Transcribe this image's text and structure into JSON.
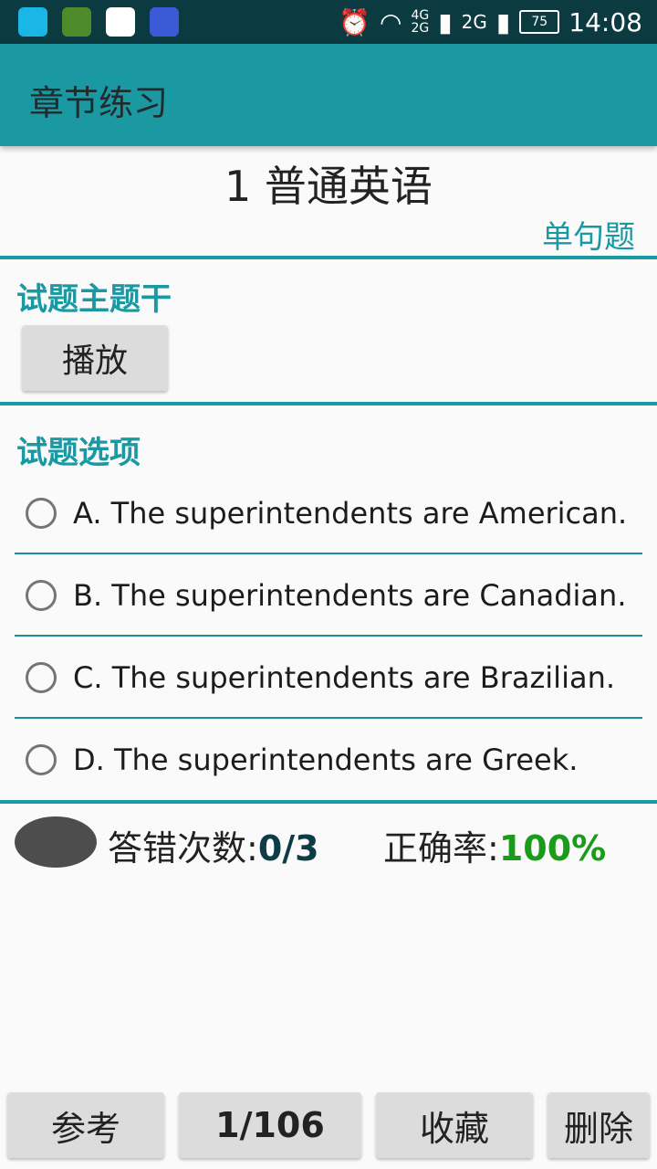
{
  "status_bar": {
    "net_4g": "4G",
    "net_2g_small": "2G",
    "net_2g": "2G",
    "battery": "75",
    "time": "14:08"
  },
  "app_bar": {
    "title": "章节练习"
  },
  "chapter": {
    "title": "1 普通英语",
    "question_type": "单句题"
  },
  "stem": {
    "label": "试题主题干",
    "play_label": "播放"
  },
  "options": {
    "label": "试题选项",
    "items": [
      {
        "text": "A. The superintendents are American."
      },
      {
        "text": "B. The superintendents are Canadian."
      },
      {
        "text": "C. The superintendents are Brazilian."
      },
      {
        "text": "D. The superintendents are Greek."
      }
    ]
  },
  "stats": {
    "wrong_label": "答错次数:",
    "wrong_value": "0/3",
    "accuracy_label": "正确率:",
    "accuracy_value": "100%"
  },
  "bottom": {
    "reference": "参考",
    "page": "1/106",
    "favorite": "收藏",
    "delete": "删除"
  }
}
